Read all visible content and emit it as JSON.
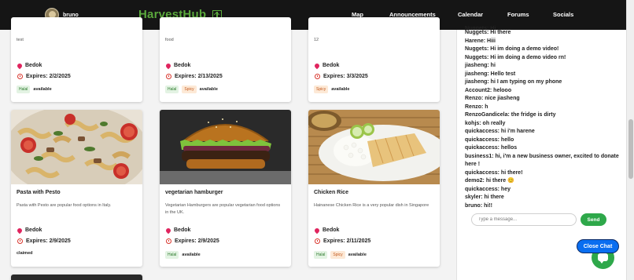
{
  "user": {
    "name": "bruno"
  },
  "brand": {
    "name": "HarvestHub",
    "color": "#5aa83c"
  },
  "nav": {
    "links": [
      "Map",
      "Announcements",
      "Calendar",
      "Forums",
      "Socials"
    ]
  },
  "top_cards": [
    {
      "desc": "test",
      "location": "Bedok",
      "expires": "Expires: 2/2/2025",
      "tags": [
        "Halal"
      ],
      "status": "available"
    },
    {
      "desc": "food",
      "location": "Bedok",
      "expires": "Expires: 2/13/2025",
      "tags": [
        "Halal",
        "Spicy"
      ],
      "status": "available"
    },
    {
      "desc": "12",
      "location": "Bedok",
      "expires": "Expires: 3/3/2025",
      "tags": [
        "Spicy"
      ],
      "status": "available"
    }
  ],
  "cards": [
    {
      "title": "Pasta with Pesto",
      "desc": "Pasta with Pesto are popular food options in Italy.",
      "location": "Bedok",
      "expires": "Expires: 2/9/2025",
      "tags": [],
      "status": "claimed"
    },
    {
      "title": "vegetarian hamburger",
      "desc": "Vegetarian Hamburgers are popular vegetarian food options in the UK.",
      "location": "Bedok",
      "expires": "Expires: 2/9/2025",
      "tags": [
        "Halal"
      ],
      "status": "available"
    },
    {
      "title": "Chicken Rice",
      "desc": "Hainanese Chicken Rice is a very popular dish in Singapore",
      "location": "Bedok",
      "expires": "Expires: 2/11/2025",
      "tags": [
        "Halal",
        "Spicy"
      ],
      "status": "available"
    }
  ],
  "chat": {
    "messages": [
      "Nuggets: Hi there",
      "Harene: Hiii",
      "Nuggets: Hi im doing a demo video!",
      "Nuggets: Hi im doing a demo video rn!",
      "jiasheng: hi",
      "jiasheng: Hello test",
      "jiasheng: hi I am typing on my phone",
      "Account2: helooo",
      "Renzo: nice jiasheng",
      "Renzo: h",
      "RenzoGandicela: the fridge is dirty",
      "kohjs: oh really",
      "quickaccess: hi i'm harene",
      "quickaccess: hello",
      "quickaccess: hellos",
      "business1: hi, i'm a new business owner, excited to donate here !",
      "quickaccess: hi there!",
      "demo2: hi there 😊",
      "quickaccess: hey",
      "skyler: hi there",
      "bruno: hi!!"
    ],
    "placeholder": "Type a message...",
    "send_label": "Send",
    "close_label": "Close Chat"
  }
}
